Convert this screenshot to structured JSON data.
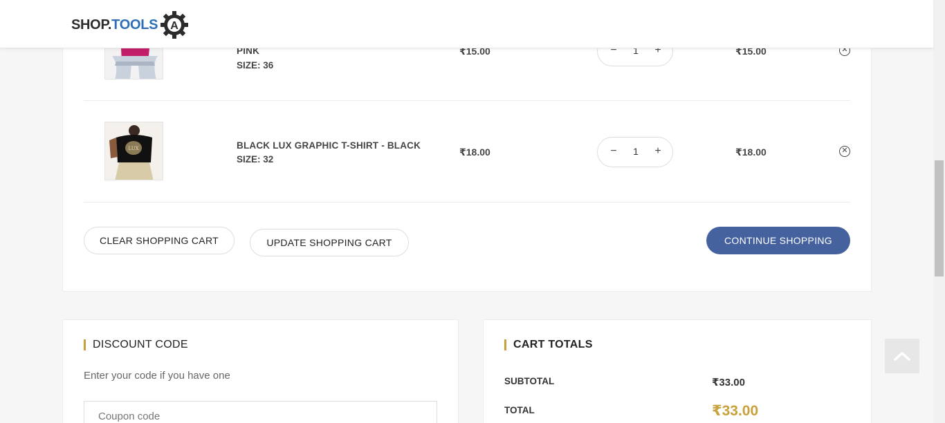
{
  "header": {
    "logo_part1": "SHOP.",
    "logo_part2": "TOOLS",
    "logo_badge": "A"
  },
  "cart": {
    "items": [
      {
        "name": "PINK",
        "size": "SIZE: 36",
        "price": "₹15.00",
        "quantity": "1",
        "subtotal": "₹15.00"
      },
      {
        "name": "BLACK LUX GRAPHIC T-SHIRT - BLACK",
        "size": "SIZE: 32",
        "price": "₹18.00",
        "quantity": "1",
        "subtotal": "₹18.00",
        "thumb_text": "LUX"
      }
    ],
    "clear_label": "CLEAR SHOPPING CART",
    "update_label": "UPDATE SHOPPING CART",
    "continue_label": "CONTINUE SHOPPING"
  },
  "discount": {
    "title": "DISCOUNT CODE",
    "description": "Enter your code if you have one",
    "placeholder": "Coupon code"
  },
  "totals": {
    "title": "CART TOTALS",
    "subtotal_label": "SUBTOTAL",
    "subtotal_value": "₹33.00",
    "total_label": "TOTAL",
    "total_value": "₹33.00"
  },
  "colors": {
    "primary_button": "#45629f",
    "accent_gold": "#c9a13a",
    "logo_blue": "#2d6fb7"
  },
  "icons": {
    "remove": "close-circle-icon",
    "back_to_top": "chevron-up-icon",
    "logo": "gear-icon"
  }
}
